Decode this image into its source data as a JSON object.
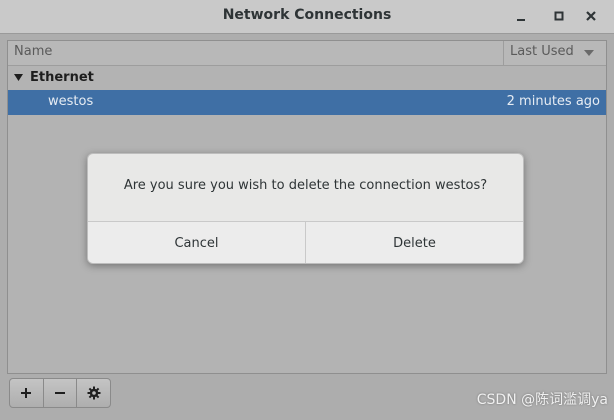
{
  "window": {
    "title": "Network Connections",
    "controls": [
      "minimize-icon",
      "maximize-icon",
      "close-icon"
    ]
  },
  "list": {
    "columns": {
      "name": "Name",
      "last_used": "Last Used"
    },
    "groups": [
      {
        "label": "Ethernet",
        "expanded": true,
        "connections": [
          {
            "name": "westos",
            "last_used": "2 minutes ago",
            "selected": true
          }
        ]
      }
    ]
  },
  "toolbar": {
    "buttons": [
      {
        "label": "+",
        "icon": "add-icon"
      },
      {
        "label": "−",
        "icon": "remove-icon"
      },
      {
        "label": "",
        "icon": "gear-icon"
      }
    ]
  },
  "dialog": {
    "message": "Are you sure you wish to delete the connection westos?",
    "cancel_label": "Cancel",
    "delete_label": "Delete"
  },
  "watermark": "CSDN @陈词滥调ya",
  "colors": {
    "selection": "#3f6fa5",
    "background": "#adadad",
    "dialog": "#e8e8e7"
  }
}
